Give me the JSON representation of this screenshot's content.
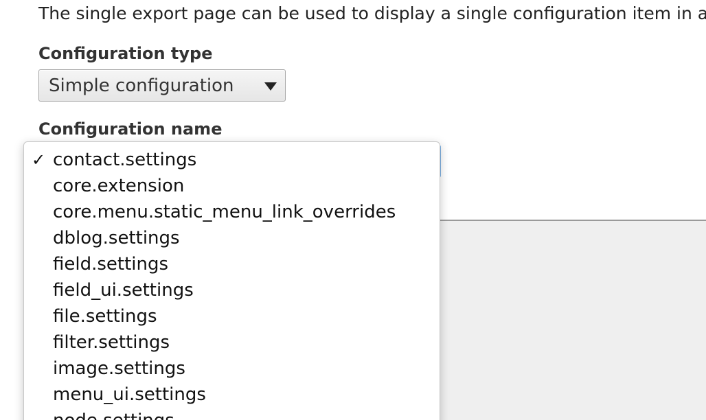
{
  "intro_text": "The single export page can be used to display a single configuration item in a",
  "config_type": {
    "label": "Configuration type",
    "selected": "Simple configuration"
  },
  "config_name": {
    "label": "Configuration name",
    "selected_index": 0,
    "check_glyph": "✓",
    "options": [
      "contact.settings",
      "core.extension",
      "core.menu.static_menu_link_overrides",
      "dblog.settings",
      "field.settings",
      "field_ui.settings",
      "file.settings",
      "filter.settings",
      "image.settings",
      "menu_ui.settings",
      "node.settings"
    ]
  },
  "colors": {
    "focus_border": "#7fb3e6",
    "text": "#222222"
  }
}
